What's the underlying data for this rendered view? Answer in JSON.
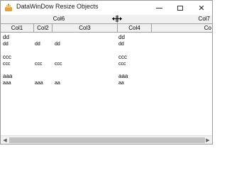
{
  "window": {
    "title": "DataWinDow Resize Objects",
    "minimize": "–",
    "maximize": "□",
    "close": "✕"
  },
  "header_groups": [
    {
      "label": "Col6"
    },
    {
      "label": "Col7"
    }
  ],
  "columns": [
    {
      "label": "Col1"
    },
    {
      "label": "Col2"
    },
    {
      "label": "Col3"
    },
    {
      "label": "Col4"
    },
    {
      "label": "Co"
    }
  ],
  "rows": [
    {
      "group": "dd",
      "cells": [
        "dd",
        "dd",
        "dd",
        "dd"
      ],
      "group_right": "dd"
    },
    {
      "group": "ccc",
      "cells": [
        "ccc",
        "ccc",
        "ccc",
        "ccc"
      ],
      "group_right": "ccc"
    },
    {
      "group": "aaa",
      "cells": [
        "aaa",
        "aaa",
        "aa",
        "aa"
      ],
      "group_right": "aaa"
    }
  ],
  "scrollbar": {
    "left_arrow": "◀",
    "right_arrow": "▶"
  },
  "colors": {
    "header_bg": "#f0f0f0",
    "border": "#a0a0a0",
    "app_icon": "#e8a23a"
  },
  "icons": {
    "app": "app-icon",
    "cursor": "column-resize-cursor"
  }
}
